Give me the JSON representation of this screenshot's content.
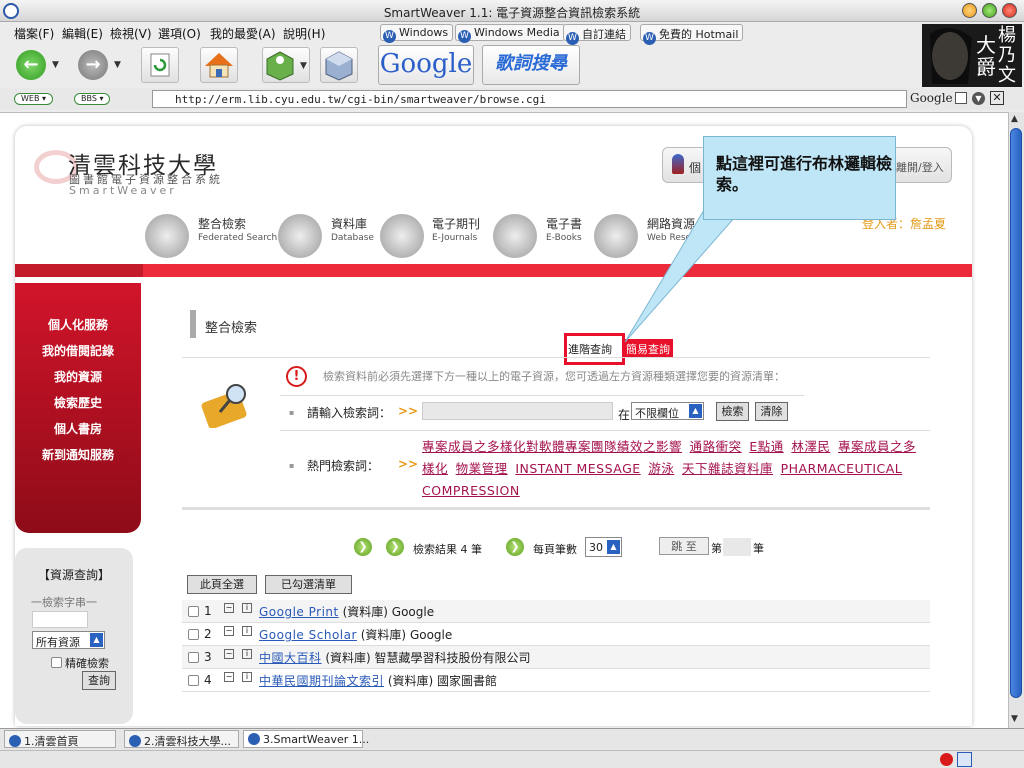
{
  "window": {
    "title": "SmartWeaver 1.1: 電子資源整合資訊檢索系統"
  },
  "menu": [
    "檔案(F)",
    "編輯(E)",
    "檢視(V)",
    "選項(O)",
    "我的最愛(A)",
    "說明(H)"
  ],
  "bookmarks": [
    "Windows",
    "Windows Media",
    "自訂連結",
    "免費的 Hotmail"
  ],
  "toolbar": {
    "google_label": "Google",
    "lyrics_label": "歌詞搜尋"
  },
  "ad": {
    "line1": "楊乃文",
    "line2": "大爵"
  },
  "address": {
    "chip1": "WEB",
    "chip2": "BBS",
    "url": "http://erm.lib.cyu.edu.tw/cgi-bin/smartweaver/browse.cgi",
    "engine": "Google"
  },
  "site": {
    "name": "清雲科技大學",
    "subtitle": "圖書館電子資源整合系統",
    "brand": "SmartWeaver",
    "nav": [
      {
        "zh": "整合檢索",
        "en": "Federated Search"
      },
      {
        "zh": "資料庫",
        "en": "Database"
      },
      {
        "zh": "電子期刊",
        "en": "E-Journals"
      },
      {
        "zh": "電子書",
        "en": "E-Books"
      },
      {
        "zh": "網路資源",
        "en": "Web Resources"
      }
    ],
    "login_link": "離開/登入",
    "login_prefix": "個",
    "login_user": "登入者：詹孟夏"
  },
  "leftnav": [
    "個人化服務",
    "我的借閱記錄",
    "我的資源",
    "檢索歷史",
    "個人書房",
    "新到通知服務"
  ],
  "leftsearch": {
    "title": "【資源查詢】",
    "label": "一檢索字串一",
    "select": "所有資源",
    "exact": "精確檢索",
    "button": "查詢"
  },
  "main": {
    "section_title": "整合檢索",
    "tab_advanced": "進階查詢",
    "tab_simple": "簡易查詢",
    "notice": "檢索資料前必須先選擇下方一種以上的電子資源，您可透過左方資源種類選擇您要的資源清單：",
    "query_label": "請輸入檢索詞：",
    "in_label": "在",
    "field_select": "不限欄位",
    "search_btn": "檢索",
    "clear_btn": "清除",
    "hot_label": "熱門檢索詞：",
    "hot_terms": [
      "專案成員之多樣化對軟體專案團隊績效之影響",
      "通路衝突",
      "E點通",
      "林澤民",
      "專案成員之多樣化",
      "物業管理",
      "INSTANT MESSAGE",
      "游泳",
      "天下雜誌資料庫",
      "PHARMACEUTICAL COMPRESSION"
    ],
    "result_text": "檢索結果 4 筆",
    "per_page_label": "每頁筆數",
    "per_page": "30",
    "jump_btn": "跳 至",
    "page_prefix": "第",
    "page_suffix": "筆",
    "select_all": "此頁全選",
    "selected_list": "已勾選清單",
    "results": [
      {
        "n": "1",
        "link": "Google Print",
        "type": "(資料庫)",
        "vendor": "Google"
      },
      {
        "n": "2",
        "link": "Google Scholar",
        "type": "(資料庫)",
        "vendor": "Google"
      },
      {
        "n": "3",
        "link": "中國大百科",
        "type": "(資料庫)",
        "vendor": "智慧藏學習科技股份有限公司"
      },
      {
        "n": "4",
        "link": "中華民國期刊論文索引",
        "type": "(資料庫)",
        "vendor": "國家圖書館"
      }
    ]
  },
  "callout": "點這裡可進行布林邏輯檢索。",
  "tabs": [
    "1.清雲首頁",
    "2.清雲科技大學...",
    "3.SmartWeaver 1..."
  ]
}
